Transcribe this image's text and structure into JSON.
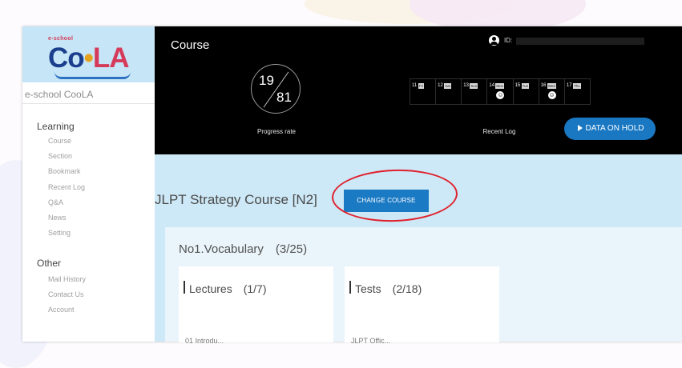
{
  "sidebar": {
    "logo_small": "e-school",
    "logo_main_left": "Co",
    "logo_main_right": "LA",
    "site_name": "e-school CooLA",
    "learning_title": "Learning",
    "learning_items": [
      "Course",
      "Section",
      "Bookmark",
      "Recent Log",
      "Q&A",
      "News",
      "Setting"
    ],
    "other_title": "Other",
    "other_items": [
      "Mail History",
      "Contact Us",
      "Account"
    ]
  },
  "header": {
    "title": "Course",
    "user_id_label": "ID:",
    "progress": {
      "done": "19",
      "total": "81",
      "label": "Progress rate"
    },
    "recent_log": {
      "label": "Recent Log",
      "days": [
        {
          "num": "11",
          "dow": "Fri",
          "face": false
        },
        {
          "num": "12",
          "dow": "Sat",
          "face": false
        },
        {
          "num": "13",
          "dow": "Sun",
          "face": false
        },
        {
          "num": "14",
          "dow": "Mon",
          "face": true
        },
        {
          "num": "15",
          "dow": "Tue",
          "face": false
        },
        {
          "num": "16",
          "dow": "Wed",
          "face": true
        },
        {
          "num": "17",
          "dow": "Thu",
          "face": false
        }
      ]
    }
  },
  "main": {
    "hold_button": "DATA ON HOLD",
    "course_title": "JLPT Strategy Course [N2]",
    "change_button": "CHANGE COURSE",
    "section_heading": "No1.Vocabulary　(3/25)",
    "cards": [
      {
        "title": "Lectures　(1/7)",
        "first_item": "01 Introdu..."
      },
      {
        "title": "Tests　(2/18)",
        "first_item": "JLPT Offic..."
      }
    ]
  },
  "colors": {
    "header_bg": "#000000",
    "content_bg": "#cde8f6",
    "accent_blue": "#1b7ac4",
    "highlight_red": "#e0212c",
    "logo_bg": "#c6e6f7"
  }
}
